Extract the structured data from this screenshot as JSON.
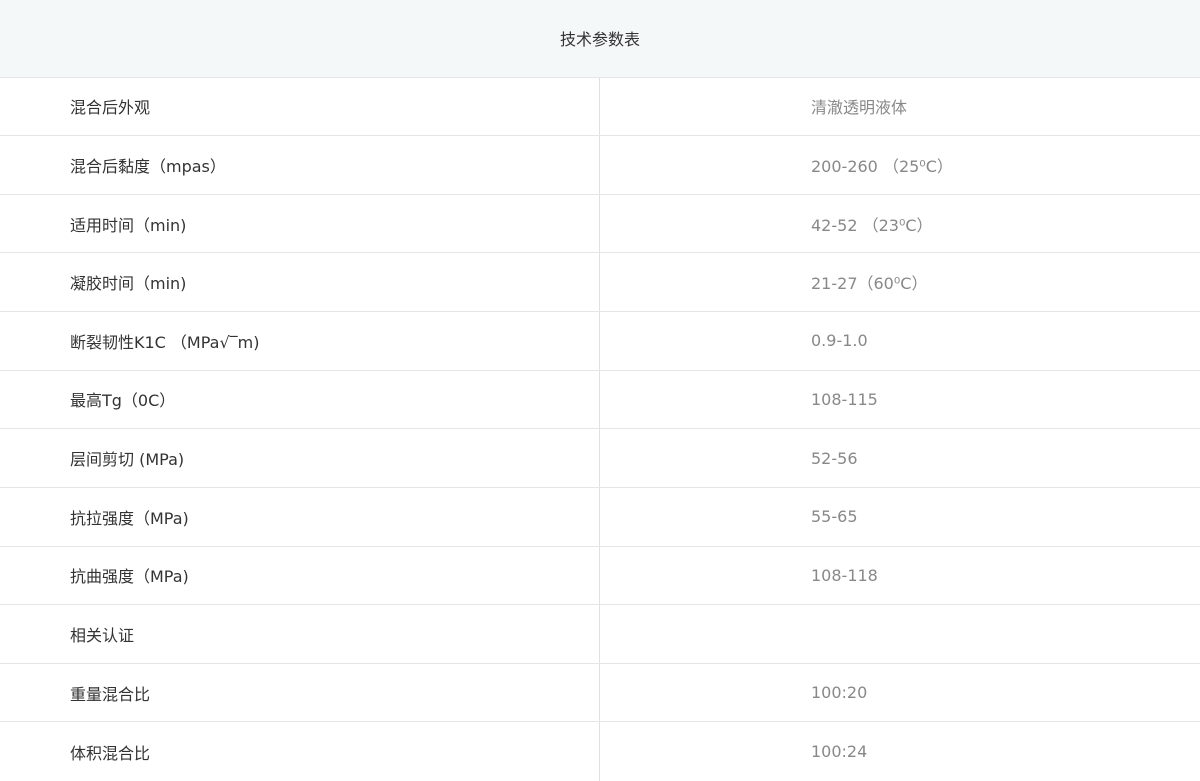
{
  "table": {
    "title": "技术参数表",
    "rows": [
      {
        "label": "混合后外观",
        "value": "清澈透明液体"
      },
      {
        "label": "混合后黏度（mpas）",
        "value": "200-260 （25⁰C）"
      },
      {
        "label": "适用时间（min)",
        "value": "42-52 （23⁰C）"
      },
      {
        "label": "凝胶时间（min)",
        "value": "21-27（60⁰C）"
      },
      {
        "label": "断裂韧性K1C （MPa√‾m)",
        "value": "0.9-1.0"
      },
      {
        "label": "最高Tg（0C）",
        "value": "108-115"
      },
      {
        "label": "层间剪切 (MPa)",
        "value": "52-56"
      },
      {
        "label": "抗拉强度（MPa)",
        "value": "55-65"
      },
      {
        "label": "抗曲强度（MPa)",
        "value": "108-118"
      },
      {
        "label": "相关认证",
        "value": ""
      },
      {
        "label": "重量混合比",
        "value": "100:20"
      },
      {
        "label": "体积混合比",
        "value": "100:24"
      }
    ]
  }
}
